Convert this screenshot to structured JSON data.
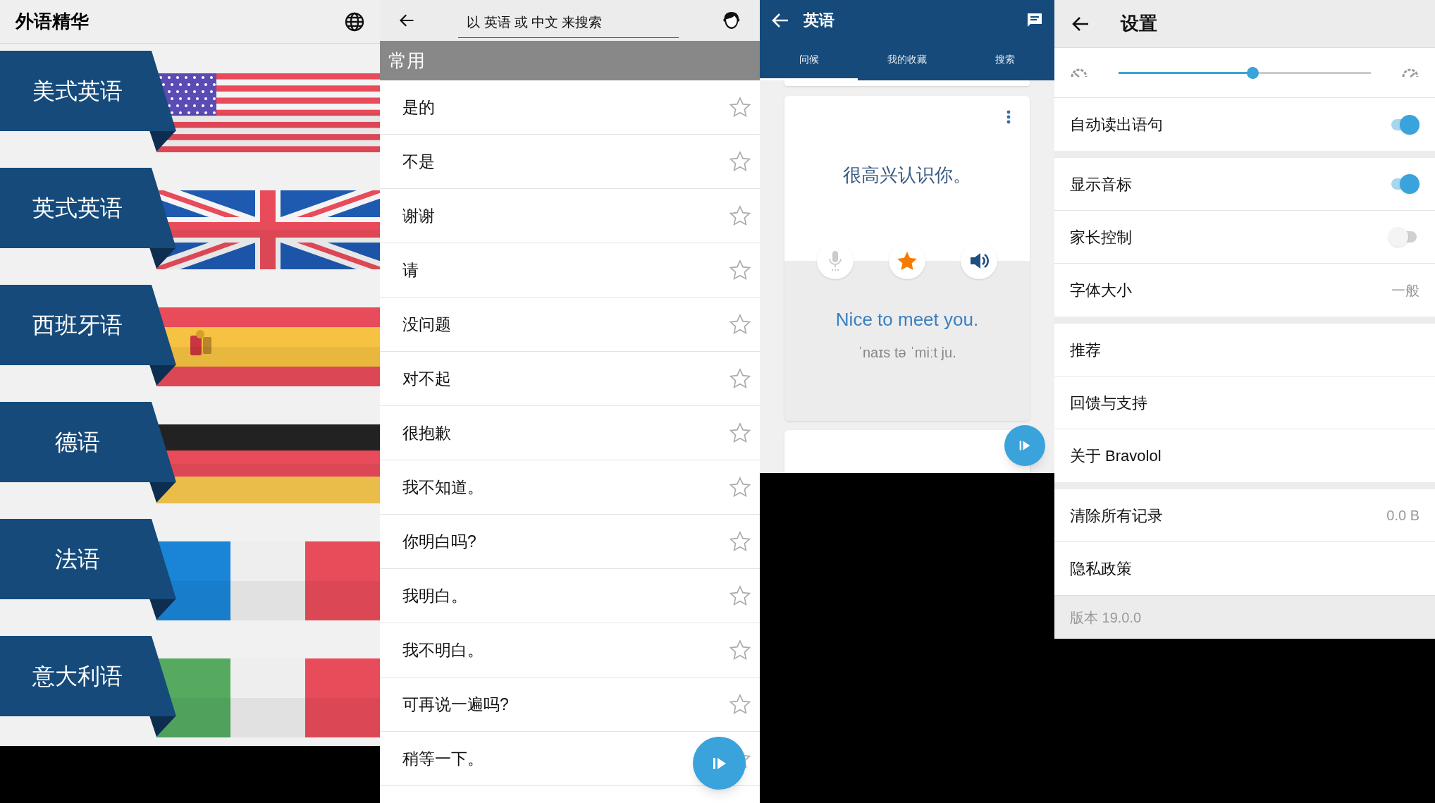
{
  "home": {
    "title": "外语精华",
    "languages": [
      {
        "label": "美式英语",
        "kind": "us"
      },
      {
        "label": "英式英语",
        "kind": "gb"
      },
      {
        "label": "西班牙语",
        "kind": "es"
      },
      {
        "label": "德语",
        "kind": "de"
      },
      {
        "label": "法语",
        "kind": "fr"
      },
      {
        "label": "意大利语",
        "kind": "it"
      }
    ]
  },
  "phrase_list": {
    "search": {
      "placeholder": "以 英语 或 中文 来搜索"
    },
    "section": "常用",
    "phrases": [
      {
        "text": "是的",
        "starred": false
      },
      {
        "text": "不是",
        "starred": false
      },
      {
        "text": "谢谢",
        "starred": false
      },
      {
        "text": "请",
        "starred": false
      },
      {
        "text": "没问题",
        "starred": false
      },
      {
        "text": "对不起",
        "starred": false
      },
      {
        "text": "很抱歉",
        "starred": false
      },
      {
        "text": "我不知道。",
        "starred": false
      },
      {
        "text": "你明白吗?",
        "starred": false
      },
      {
        "text": "我明白。",
        "starred": false
      },
      {
        "text": "我不明白。",
        "starred": false
      },
      {
        "text": "可再说一遍吗?",
        "starred": false
      },
      {
        "text": "稍等一下。",
        "starred": false
      }
    ]
  },
  "flashcard": {
    "title": "英语",
    "tabs": [
      {
        "label": "问候",
        "selected": true
      },
      {
        "label": "我的收藏",
        "selected": false
      },
      {
        "label": "搜索",
        "selected": false
      }
    ],
    "card": {
      "chinese": "很高兴认识你。",
      "english": "Nice to meet you.",
      "phonetic": "ˈnaɪs tə ˈmiːt ju.",
      "starred": true
    }
  },
  "settings": {
    "title": "设置",
    "speed": {
      "level": 0.53
    },
    "groups": [
      {
        "items": [
          {
            "kind": "toggle",
            "label": "自动读出语句",
            "on": true
          }
        ]
      },
      {
        "items": [
          {
            "kind": "toggle",
            "label": "显示音标",
            "on": true
          },
          {
            "kind": "toggle",
            "label": "家长控制",
            "on": false
          },
          {
            "kind": "value",
            "label": "字体大小",
            "value": "一般"
          }
        ]
      },
      {
        "items": [
          {
            "kind": "link",
            "label": "推荐"
          },
          {
            "kind": "link",
            "label": "回馈与支持"
          },
          {
            "kind": "link",
            "label": "关于 Bravolol"
          }
        ]
      },
      {
        "items": [
          {
            "kind": "value",
            "label": "清除所有记录",
            "value": "0.0 B"
          },
          {
            "kind": "link",
            "label": "隐私政策"
          }
        ]
      }
    ],
    "version": "版本 19.0.0"
  }
}
